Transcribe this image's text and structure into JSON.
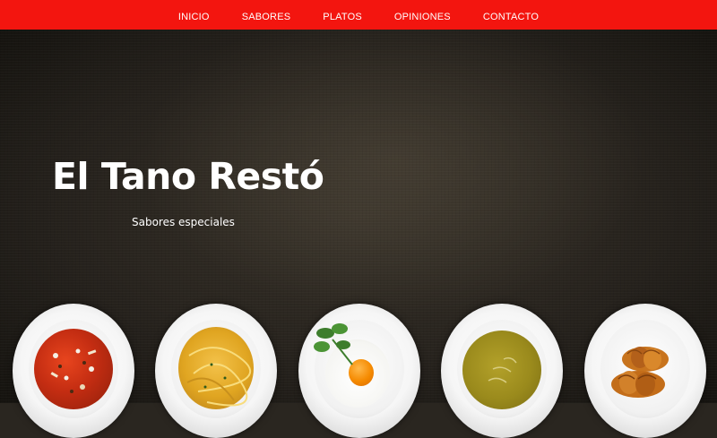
{
  "nav": {
    "items": [
      {
        "label": "INICIO"
      },
      {
        "label": "SABORES"
      },
      {
        "label": "PLATOS"
      },
      {
        "label": "OPINIONES"
      },
      {
        "label": "CONTACTO"
      }
    ]
  },
  "hero": {
    "title": "El Tano Restó",
    "subtitle": "Sabores especiales"
  },
  "colors": {
    "nav_background": "#f3150f",
    "hero_background": "#2a2620",
    "text": "#ffffff"
  },
  "plates": [
    {
      "name": "soup-plate"
    },
    {
      "name": "spaghetti-plate"
    },
    {
      "name": "fried-egg-plate"
    },
    {
      "name": "cream-soup-plate"
    },
    {
      "name": "croissant-plate"
    }
  ]
}
